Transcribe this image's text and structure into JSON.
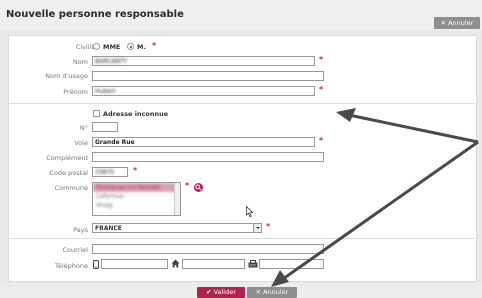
{
  "header": {
    "title": "Nouvelle personne responsable",
    "cancel_label": "✕  Annuler"
  },
  "form": {
    "civility_label": "Civilité",
    "civility_options": [
      {
        "label": "MME",
        "checked": false
      },
      {
        "label": "M.",
        "checked": true
      }
    ],
    "nom_label": "Nom",
    "nom_value": "BARCANTY",
    "nom_usage_label": "Nom d'usage",
    "nom_usage_value": "",
    "prenom_label": "Prénom",
    "prenom_value": "Hubert",
    "adresse_inconnue_label": "Adresse inconnue",
    "adresse_inconnue_checked": false,
    "numero_label": "N°",
    "numero_value": "",
    "voie_label": "Voie",
    "voie_value": "Grande Rue",
    "complement_label": "Complément",
    "complement_value": "",
    "code_postal_label": "Code postal",
    "code_postal_value": "33870",
    "commune_label": "Commune",
    "commune_options": [
      {
        "label": "Pessignac-sur-Boudet",
        "selected": true
      },
      {
        "label": "Ceformac",
        "selected": false
      },
      {
        "label": "Vivag",
        "selected": false
      }
    ],
    "pays_label": "Pays",
    "pays_value": "FRANCE",
    "courriel_label": "Courriel",
    "courriel_value": "",
    "telephone_label": "Téléphone",
    "telephone_mobile": "",
    "telephone_home": "",
    "telephone_fax": "",
    "required_marker": "*"
  },
  "footer": {
    "validate_label": "✔  Valider",
    "cancel_label": "✕  Annuler"
  },
  "colors": {
    "accent": "#b3224d",
    "required": "#c0284e",
    "neutral_button": "#8e8e8e"
  }
}
